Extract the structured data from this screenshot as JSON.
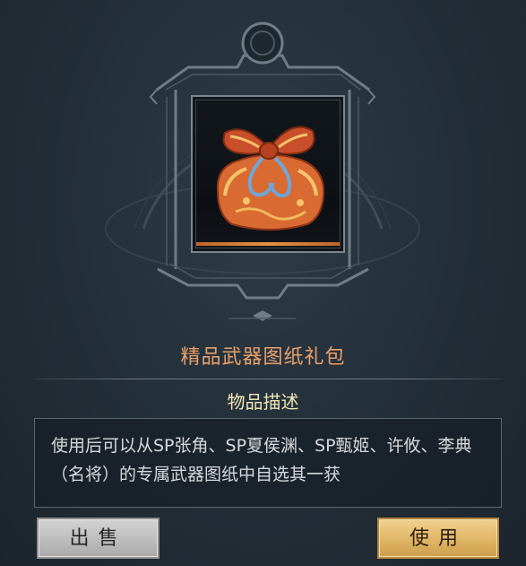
{
  "item": {
    "name": "精品武器图纸礼包",
    "icon": "gift-bundle-icon",
    "rarity_color": "#e7913f"
  },
  "description": {
    "header": "物品描述",
    "text": "使用后可以从SP张角、SP夏侯渊、SP甄姬、许攸、李典（名将）的专属武器图纸中自选其一获"
  },
  "actions": {
    "sell_label": "出售",
    "use_label": "使用"
  },
  "colors": {
    "title": "#e8a06a",
    "header": "#eee6b6",
    "use_button": "#e0b566",
    "sell_button": "#bdbdbd"
  }
}
